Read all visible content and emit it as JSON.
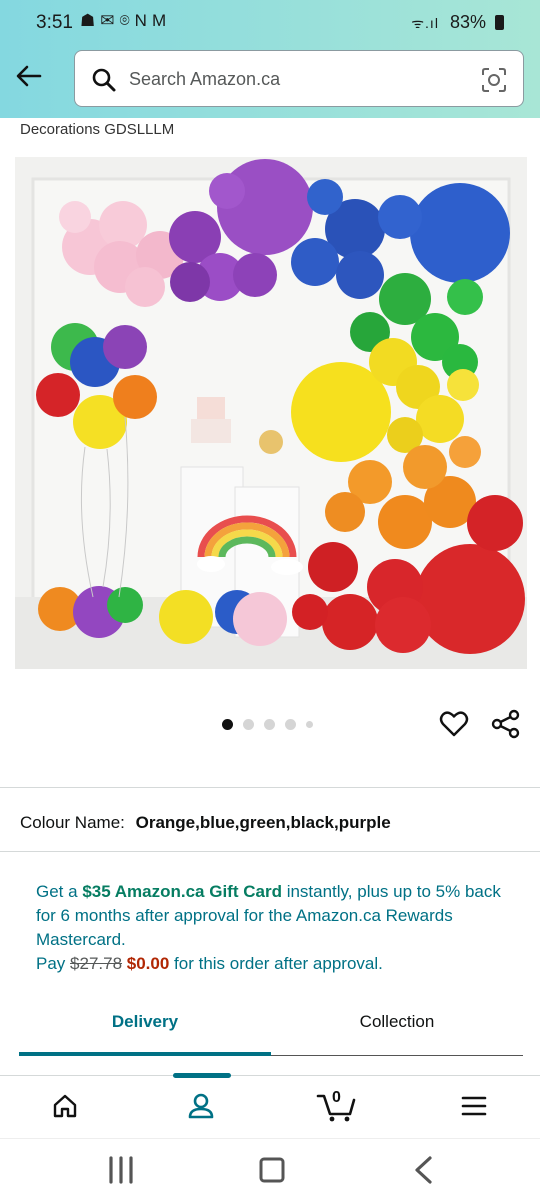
{
  "status": {
    "time": "3:51",
    "notif_icons": "☗✉⌾NM",
    "battery": "83%",
    "signal": "ᯤ.ıl"
  },
  "search": {
    "placeholder": "Search Amazon.ca"
  },
  "product": {
    "subtitle": "Decorations GDSLLLM",
    "image_dots_total": 5,
    "image_dots_active": 1
  },
  "colour": {
    "label": "Colour Name:",
    "value": "Orange,blue,green,black,purple"
  },
  "promo": {
    "line_a": "Get a ",
    "gift": "$35 Amazon.ca Gift Card",
    "line_b": " instantly, plus up to 5% back for 6 months after approval for the Amazon.ca Rewards Mastercard.",
    "pay": "Pay ",
    "old_price": "$27.78",
    "new_price": "$0.00",
    "tail": " for this order after approval."
  },
  "tabs": [
    {
      "label": "Delivery",
      "active": true
    },
    {
      "label": "Collection",
      "active": false
    }
  ],
  "bottom_nav": {
    "cart_count": "0",
    "items": [
      "home-icon",
      "account-icon",
      "cart-icon",
      "menu-icon"
    ]
  },
  "colors": {
    "accent": "#007185",
    "green": "#067d62",
    "price_red": "#b12704",
    "header_bg": "#84d8e0"
  }
}
